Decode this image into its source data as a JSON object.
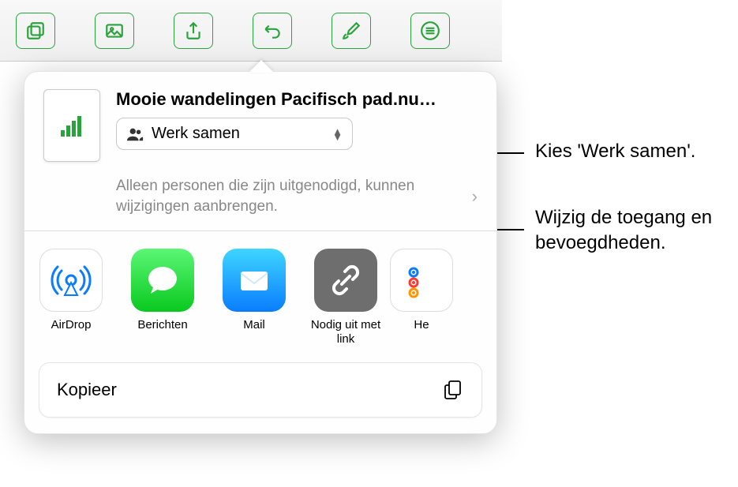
{
  "toolbar": {
    "buttons": [
      "insert",
      "media",
      "share",
      "undo",
      "format",
      "more"
    ]
  },
  "sheet": {
    "doc_title": "Mooie wandelingen Pacifisch pad.nu…",
    "collab": {
      "label": "Werk samen"
    },
    "access_text": "Alleen personen die zijn uitgenodigd, kunnen wijzigingen aanbrengen.",
    "apps": [
      {
        "id": "airdrop",
        "label": "AirDrop"
      },
      {
        "id": "messages",
        "label": "Berichten"
      },
      {
        "id": "mail",
        "label": "Mail"
      },
      {
        "id": "link",
        "label": "Nodig uit met link"
      },
      {
        "id": "reminders",
        "label": "He"
      }
    ],
    "copy_action": "Kopieer"
  },
  "callouts": {
    "c1": "Kies 'Werk samen'.",
    "c2": "Wijzig de toegang en bevoegdheden."
  }
}
